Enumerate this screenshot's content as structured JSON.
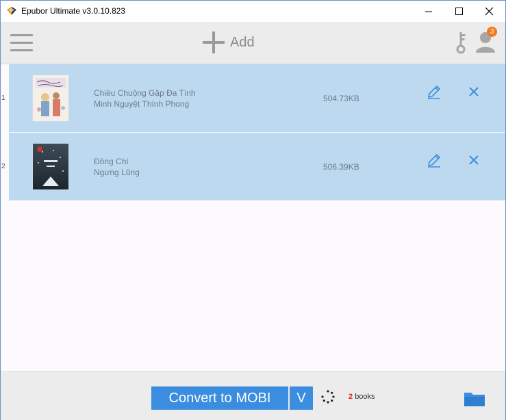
{
  "window": {
    "title": "Epubor Ultimate v3.0.10.823"
  },
  "toolbar": {
    "add_label": "Add",
    "notification_count": "3"
  },
  "books": [
    {
      "index": "1",
      "title": "Chiều Chuộng Gặp Đa Tình",
      "author": "Minh Nguyệt Thính Phong",
      "size": "504.73KB"
    },
    {
      "index": "2",
      "title": "Đông Chí",
      "author": "Ngưng Lũng",
      "size": "506.39KB"
    }
  ],
  "footer": {
    "convert_label": "Convert to MOBI",
    "dropdown_glyph": "V",
    "count_num": "2",
    "count_label": "books"
  },
  "colors": {
    "accent": "#3b8ddf",
    "row_bg": "#bcd9f0",
    "badge": "#f07a22"
  }
}
